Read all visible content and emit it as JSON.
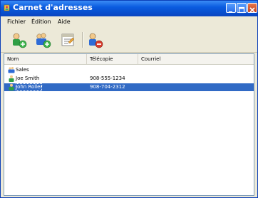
{
  "window": {
    "title": "Carnet d'adresses"
  },
  "menu": {
    "items": [
      {
        "label": "Fichier"
      },
      {
        "label": "Édition"
      },
      {
        "label": "Aide"
      }
    ]
  },
  "toolbar": {
    "tools": [
      {
        "icon": "new-contact-icon"
      },
      {
        "icon": "new-group-icon"
      },
      {
        "icon": "properties-icon"
      },
      {
        "icon": "delete-icon"
      }
    ]
  },
  "list": {
    "columns": [
      {
        "label": "Nom"
      },
      {
        "label": "Télécopie"
      },
      {
        "label": "Courriel"
      }
    ],
    "rows": [
      {
        "icon": "group-icon",
        "name": "Sales",
        "fax": "",
        "email": "",
        "selected": false
      },
      {
        "icon": "contact-icon",
        "name": "Joe Smith",
        "fax": "908-555-1234",
        "email": "",
        "selected": false
      },
      {
        "icon": "contact-icon",
        "name": "John Roller",
        "fax": "908-704-2312",
        "email": "",
        "selected": true
      }
    ]
  },
  "colors": {
    "titlebar": "#0a5ce0",
    "selection": "#316ac5",
    "chrome": "#ece9d8"
  }
}
